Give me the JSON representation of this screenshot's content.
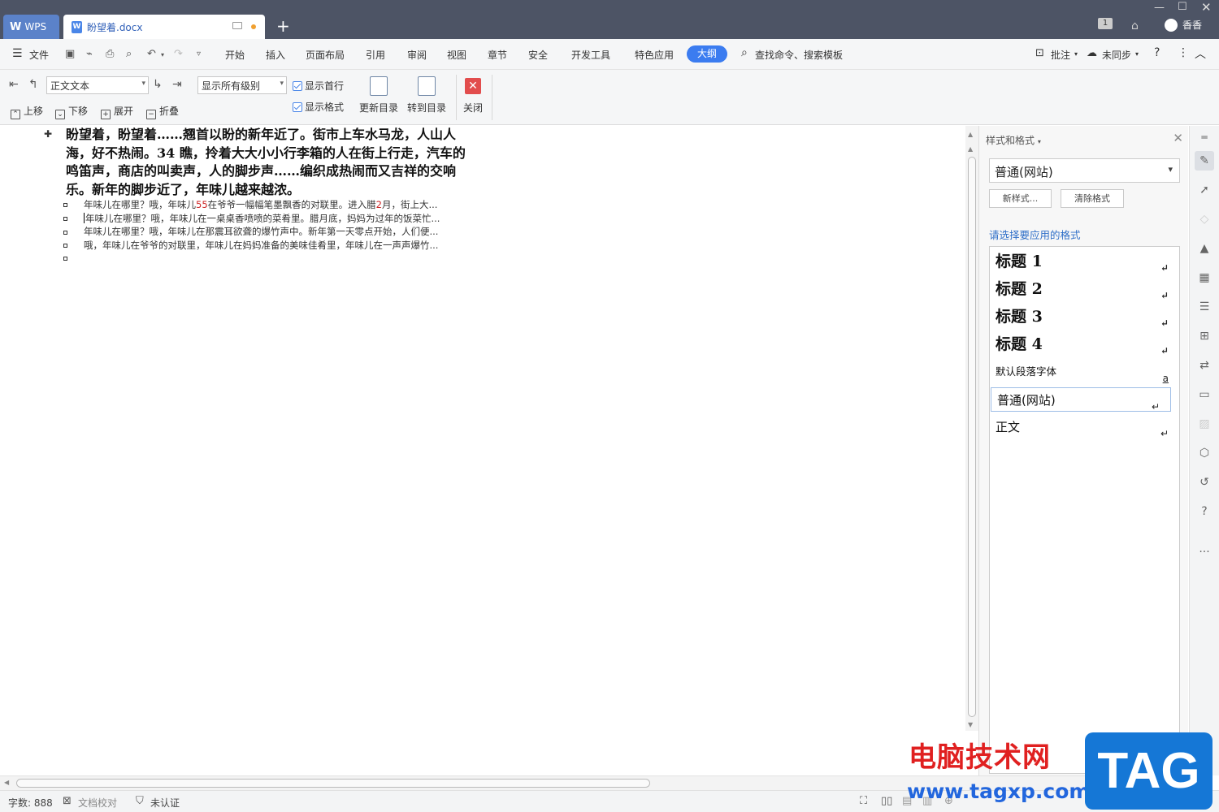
{
  "titlebar": {
    "wps_tab": "WPS",
    "doc_tab": "盼望着.docx",
    "doc_icon": "W",
    "badge": "1",
    "user": "香香",
    "add": "+"
  },
  "menu": {
    "file": "文件",
    "items": [
      "开始",
      "插入",
      "页面布局",
      "引用",
      "审阅",
      "视图",
      "章节",
      "安全",
      "开发工具",
      "特色应用"
    ],
    "active": "大纲",
    "search": "查找命令、搜索模板",
    "comment": "批注",
    "sync": "未同步"
  },
  "ribbon": {
    "style_select": "正文文本",
    "level_select": "显示所有级别",
    "show_first_line": "显示首行",
    "show_format": "显示格式",
    "move_up": "上移",
    "move_down": "下移",
    "expand": "展开",
    "collapse": "折叠",
    "update_toc": "更新目录",
    "goto_toc": "转到目录",
    "close": "关闭"
  },
  "document": {
    "heading": "盼望着，盼望着……翘首以盼的新年近了。街市上车水马龙，人山人海，好不热闹。34 瞧，拎着大大小小行李箱的人在街上行走，汽车的鸣笛声，商店的叫卖声，人的脚步声……编织成热闹而又吉祥的交响乐。新年的脚步近了，年味儿越来越浓。",
    "line1_a": "年味儿在哪里？哦，年味儿",
    "line1_num1": "55",
    "line1_b": "在爷爷一幅幅笔墨飘香的对联里。进入腊",
    "line1_num2": "2",
    "line1_c": "月，街上大...",
    "line2": "年味儿在哪里？哦，年味儿在一桌桌香喷喷的菜肴里。腊月底，妈妈为过年的饭菜忙...",
    "line3": "年味儿在哪里？哦，年味儿在那震耳欲聋的爆竹声中。新年第一天零点开始，人们便...",
    "line4": "哦，年味儿在爷爷的对联里，年味儿在妈妈准备的美味佳肴里，年味儿在一声声爆竹..."
  },
  "panel": {
    "title": "样式和格式",
    "current_style": "普通(网站)",
    "new_style": "新样式...",
    "clear_format": "清除格式",
    "hint": "请选择要应用的格式",
    "styles": [
      {
        "label": "标题  1",
        "mark": "↵"
      },
      {
        "label": "标题  2",
        "mark": "↵"
      },
      {
        "label": "标题  3",
        "mark": "↵"
      },
      {
        "label": "标题  4",
        "mark": "↵"
      },
      {
        "label": "默认段落字体",
        "mark": "a"
      },
      {
        "label": "普通(网站)",
        "mark": "↵"
      },
      {
        "label": "正文",
        "mark": "↵"
      }
    ]
  },
  "status": {
    "word_count": "字数: 888",
    "proofread": "文档校对",
    "unverified": "未认证"
  },
  "watermark": {
    "site_name": "电脑技术网",
    "url": "www.tagxp.com",
    "tag": "TAG"
  }
}
